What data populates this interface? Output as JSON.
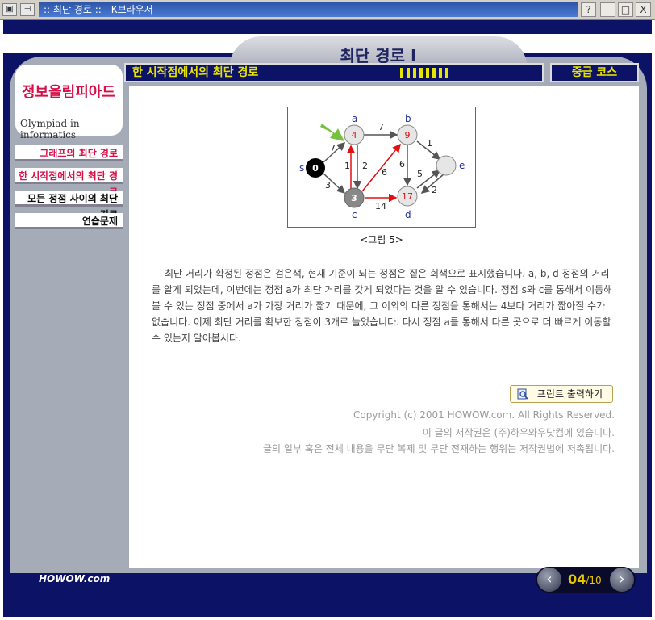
{
  "window": {
    "title": ":: 최단 경로 :: - K브라우저",
    "help": "?",
    "minimize": "-",
    "maximize": "□",
    "close": "X"
  },
  "header": {
    "tab_title": "최단 경로 I",
    "section_title": "한 시작점에서의 최단 경로",
    "course": "중급 코스"
  },
  "logo": {
    "korean": "정보올림피아드",
    "english": "Olympiad in informatics"
  },
  "nav": {
    "items": [
      {
        "label": "그래프의 최단 경로",
        "color": "#d61048"
      },
      {
        "label": "한 시작점에서의 최단 경로",
        "color": "#d61048"
      },
      {
        "label": "모든 정점 사이의 최단 경로",
        "color": "#111111"
      },
      {
        "label": "연습문제",
        "color": "#111111"
      }
    ]
  },
  "graph": {
    "nodes": [
      {
        "id": "s",
        "value": "0"
      },
      {
        "id": "a",
        "value": "4"
      },
      {
        "id": "b",
        "value": "9"
      },
      {
        "id": "c",
        "value": "3"
      },
      {
        "id": "d",
        "value": "17"
      },
      {
        "id": "e",
        "value": ""
      }
    ],
    "edges": [
      {
        "label": "7"
      },
      {
        "label": "3"
      },
      {
        "label": "7"
      },
      {
        "label": "1"
      },
      {
        "label": "2"
      },
      {
        "label": "6"
      },
      {
        "label": "14"
      },
      {
        "label": "1"
      },
      {
        "label": "6"
      },
      {
        "label": "5"
      },
      {
        "label": "2"
      }
    ],
    "caption": "<그림 5>"
  },
  "content": {
    "paragraph": "최단 거리가 확정된 정점은 검은색, 현재 기준이 되는 정점은 짙은 회색으로 표시했습니다. a, b, d 정점의 거리를 알게 되었는데, 이번에는 정점 a가 최단 거리를 갖게 되었다는 것을 알 수 있습니다. 정점 s와 c를 통해서 이동해 볼 수 있는 정점 중에서 a가 가장 거리가 짧기 때문에, 그 이외의 다른 정점을 통해서는 4보다 거리가 짧아질 수가 없습니다. 이제 최단 거리를 확보한 정점이 3개로 늘었습니다. 다시 정점 a를 통해서 다른 곳으로 더 빠르게 이동할 수 있는지 알아봅시다.",
    "print_label": "프린트 출력하기",
    "copyright": [
      "Copyright (c) 2001 HOWOW.com. All Rights Reserved.",
      "이 글의 저작권은 (주)하우와우닷컴에 있습니다.",
      "글의 일부 혹은 전체 내용을 무단 복제 및 무단 전재하는 행위는 저작권법에 저촉됩니다."
    ]
  },
  "footer": {
    "brand": "HOWOW.com",
    "page_current": "04",
    "page_total": "10",
    "prev": "‹",
    "next": "›"
  }
}
